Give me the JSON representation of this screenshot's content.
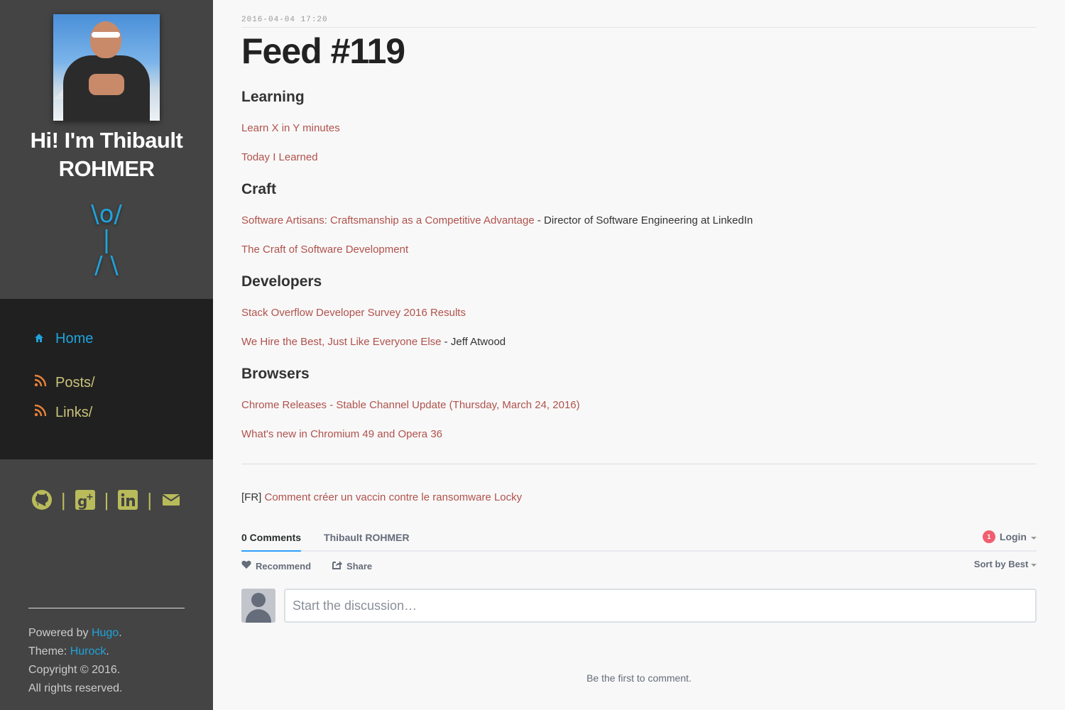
{
  "sidebar": {
    "name_line1": "Hi! I'm Thibault",
    "name_line2": "ROHMER",
    "ascii": "\\o/\n|\n/ \\",
    "nav": [
      {
        "label": "Home",
        "icon": "home-icon"
      },
      {
        "label": "Posts/",
        "icon": "rss-icon"
      },
      {
        "label": "Links/",
        "icon": "rss-icon"
      }
    ],
    "social_icons": [
      "github-icon",
      "google-plus-icon",
      "linkedin-icon",
      "mail-icon"
    ],
    "footer": {
      "powered_prefix": "Powered by ",
      "powered_link": "Hugo",
      "theme_prefix": "Theme: ",
      "theme_link": "Hurock",
      "copyright": "Copyright © 2016.",
      "rights": "All rights reserved."
    }
  },
  "post": {
    "date": "2016-04-04 17:20",
    "title": "Feed #119",
    "sections": [
      {
        "heading": "Learning",
        "links": [
          {
            "text": "Learn X in Y minutes",
            "suffix": ""
          },
          {
            "text": "Today I Learned",
            "suffix": ""
          }
        ]
      },
      {
        "heading": "Craft",
        "links": [
          {
            "text": "Software Artisans: Craftsmanship as a Competitive Advantage",
            "suffix": " - Director of Software Engineering at LinkedIn"
          },
          {
            "text": "The Craft of Software Development",
            "suffix": ""
          }
        ]
      },
      {
        "heading": "Developers",
        "links": [
          {
            "text": "Stack Overflow Developer Survey 2016 Results",
            "suffix": ""
          },
          {
            "text": "We Hire the Best, Just Like Everyone Else",
            "suffix": " - Jeff Atwood"
          }
        ]
      },
      {
        "heading": "Browsers",
        "links": [
          {
            "text": "Chrome Releases - Stable Channel Update (Thursday, March 24, 2016)",
            "suffix": ""
          },
          {
            "text": "What's new in Chromium 49 and Opera 36",
            "suffix": ""
          }
        ]
      }
    ],
    "next_prefix": "[FR] ",
    "next_link": "Comment créer un vaccin contre le ransomware Locky"
  },
  "comments": {
    "tab_count": "0 Comments",
    "tab_site": "Thibault ROHMER",
    "login": "Login",
    "badge": "1",
    "recommend": "Recommend",
    "share": "Share",
    "sort": "Sort by Best",
    "placeholder": "Start the discussion…",
    "empty": "Be the first to comment."
  }
}
